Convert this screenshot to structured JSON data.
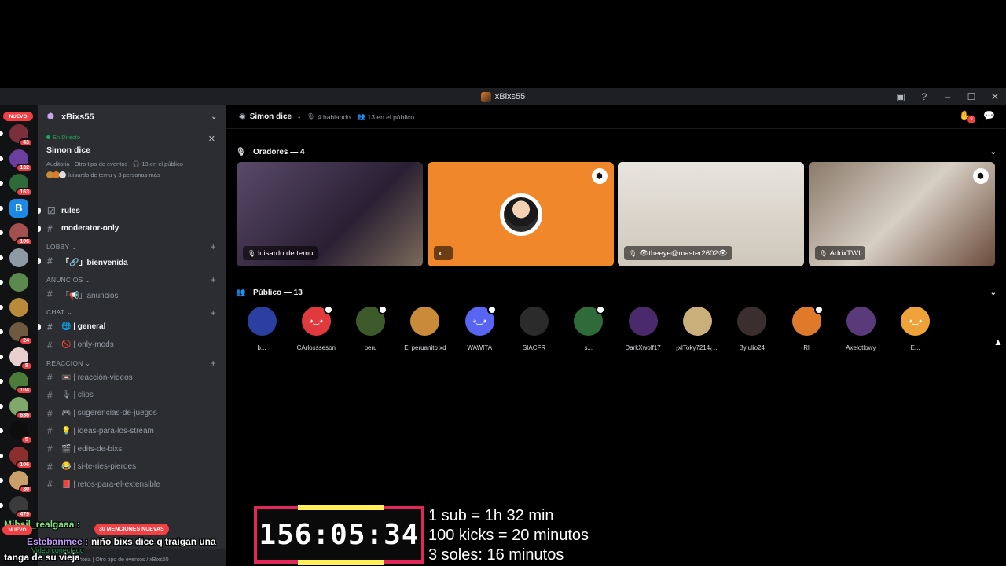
{
  "window": {
    "title": "xBixs55"
  },
  "rail": {
    "servers": [
      {
        "badge": "43",
        "color": "#7a2f3a",
        "top": 0
      },
      {
        "badge": "132",
        "color": "#6a3fa0",
        "top": 0
      },
      {
        "badge": "163",
        "color": "#2f6b3a",
        "top": 0
      },
      {
        "badge": "",
        "color": "#1e88e5",
        "top": 0,
        "letter": "B"
      },
      {
        "badge": "106",
        "color": "#a25050",
        "top": 0
      },
      {
        "badge": "",
        "color": "#8d9aa3",
        "top": 0
      },
      {
        "badge": "",
        "color": "#5c8a4e",
        "top": 0
      },
      {
        "badge": "",
        "color": "#b88b3a",
        "top": 0
      },
      {
        "badge": "24",
        "color": "#6e5b3f",
        "top": 0
      },
      {
        "badge": "8",
        "color": "#e8d0d0",
        "top": 0
      },
      {
        "badge": "104",
        "color": "#4c7b3a",
        "top": 0
      },
      {
        "badge": "636",
        "color": "#7fa86a",
        "top": 0
      },
      {
        "badge": "5",
        "color": "#0d0d0d",
        "top": 0
      },
      {
        "badge": "106",
        "color": "#8a2e2e",
        "top": 0
      },
      {
        "badge": "30",
        "color": "#c9a06a",
        "top": 0
      },
      {
        "badge": "479",
        "color": "#3b3b3b",
        "top": 0
      }
    ],
    "nuevo_label": "NUEVO"
  },
  "sidebar": {
    "server_name": "xBixs55",
    "event": {
      "live_label": "En Directo",
      "title": "Simon dice",
      "meta": "Auditoria | Otro tipo de eventos · 🎧 13 en el público",
      "people": "luisardo de temu y 3 personas más"
    },
    "channels_top": [
      {
        "name": "rules",
        "bold": true
      },
      {
        "name": "moderator-only",
        "bold": true
      }
    ],
    "categories": [
      {
        "name": "LOBBY",
        "channels": [
          {
            "name": "「🔗」bienvenida",
            "bold": true
          }
        ]
      },
      {
        "name": "ANUNCIOS",
        "channels": [
          {
            "name": "「📢」anuncios",
            "bold": false
          }
        ]
      },
      {
        "name": "CHAT",
        "channels": [
          {
            "name": "🌐 | general",
            "bold": true
          },
          {
            "name": "🚫 | only-mods",
            "bold": false
          }
        ]
      },
      {
        "name": "REACCION",
        "channels": [
          {
            "name": "📼 | reacción-videos",
            "bold": false
          },
          {
            "name": "🎙 | clips",
            "bold": false
          },
          {
            "name": "🎮 | sugerencias-de-juegos",
            "bold": false
          },
          {
            "name": "💡 | ideas-para-los-stream",
            "bold": false
          },
          {
            "name": "🎬 | edits-de-bixs",
            "bold": false
          },
          {
            "name": "😂 | si-te-ries-pierdes",
            "bold": false
          },
          {
            "name": "📕 | retos-para-el-extensible",
            "bold": false
          }
        ]
      }
    ],
    "footer_status": "Video conectado",
    "footer_sub": "Auditoria | Otro tipo de eventos / xBixs55"
  },
  "main": {
    "stage_name": "Simon dice",
    "speaking": "4 hablando",
    "audience_count": "13 en el público",
    "hand_badge": "6",
    "speakers_header": "Oradores — 4",
    "audience_header": "Público — 13",
    "speakers": [
      {
        "name": "luisardo de temu",
        "bg": "#3a2c44",
        "shield": false
      },
      {
        "name": "x...",
        "bg": "#f0872a",
        "shield": true
      },
      {
        "name": "👁theeye@master2602👁",
        "bg": "#d9d2c8",
        "shield": false
      },
      {
        "name": "AdrixTWI",
        "bg": "#b8a48a",
        "shield": true
      }
    ],
    "audience": [
      {
        "name": "b...",
        "color": "#2a3fa0",
        "mod": false
      },
      {
        "name": "CArlossseson",
        "color": "#e03a3f",
        "mod": true
      },
      {
        "name": "peru",
        "color": "#3d5a2a",
        "mod": true
      },
      {
        "name": "El peruanito xd",
        "color": "#c98a3a",
        "mod": false
      },
      {
        "name": "WAWITA",
        "color": "#5865f2",
        "mod": true
      },
      {
        "name": "SIACFR",
        "color": "#2b2b2b",
        "mod": false
      },
      {
        "name": "s...",
        "color": "#2f6b3a",
        "mod": true
      },
      {
        "name": "DarkXwolf17",
        "color": "#4a2a6a",
        "mod": false
      },
      {
        "name": "ₓxIToky7214ₓ ...",
        "color": "#c9b07a",
        "mod": false
      },
      {
        "name": "Byjulio24",
        "color": "#3a2e2e",
        "mod": false
      },
      {
        "name": "Rl",
        "color": "#e07a2b",
        "mod": true
      },
      {
        "name": "Axelotlowy",
        "color": "#5a3a7a",
        "mod": false
      },
      {
        "name": "E...",
        "color": "#f0a23a",
        "mod": false
      }
    ]
  },
  "overlay": {
    "timer": "156:05:34",
    "rules": [
      "1 sub = 1h 32 min",
      "100 kicks = 20 minutos",
      "3 soles: 16 minutos"
    ],
    "chat": [
      {
        "user": "Mihail_realgaaa :",
        "text": ""
      },
      {
        "user": "Estebanmee :",
        "text": "niño bixs dice q traigan una tanga de su vieja"
      }
    ],
    "menciones": "30 MENCIONES NUEVAS",
    "nuevo_bottom": "NUEVO"
  }
}
